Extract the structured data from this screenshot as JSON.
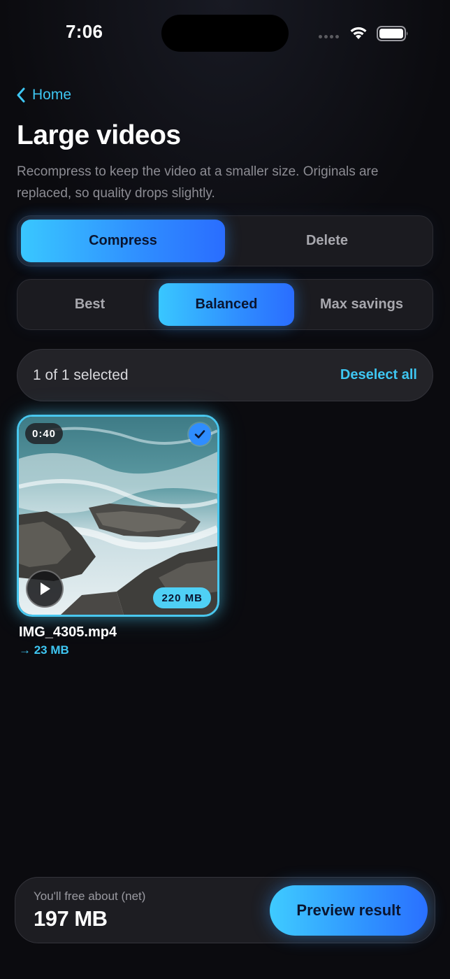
{
  "status_bar": {
    "time": "7:06",
    "icons": [
      "signal-icon",
      "wifi-icon",
      "battery-icon"
    ]
  },
  "nav": {
    "back_label": "Home",
    "back_icon": "chevron-left-icon"
  },
  "header": {
    "title": "Large videos",
    "subtitle": "Recompress to keep the video at a smaller size. Originals are replaced, so quality drops slightly."
  },
  "mode_segment": {
    "options": [
      "Compress",
      "Delete"
    ],
    "selected": "Compress"
  },
  "quality_segment": {
    "options": [
      "Best",
      "Balanced",
      "Max savings"
    ],
    "selected": "Balanced"
  },
  "selection": {
    "count_text": "1 of 1 selected",
    "deselect_label": "Deselect all"
  },
  "videos": [
    {
      "duration": "0:40",
      "size": "220 MB",
      "name": "IMG_4305.mp4",
      "new_size": "→ 23 MB",
      "selected": true
    }
  ],
  "footer": {
    "savings_label": "You'll free about (net)",
    "savings_value": "197 MB",
    "preview_label": "Preview result"
  },
  "colors": {
    "accent": "#3ec6f2",
    "accent_gradient_start": "#39c7ff",
    "accent_gradient_end": "#2a6dff",
    "background": "#0b0b0f",
    "card_border": "#49c7ee"
  }
}
